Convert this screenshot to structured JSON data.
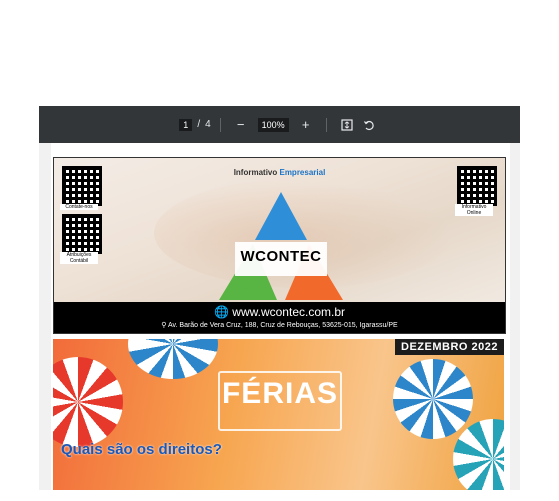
{
  "toolbar": {
    "page_current": "1",
    "page_separator": "/",
    "page_total": "4",
    "zoom": "100%",
    "zoom_out_icon": "minus-icon",
    "zoom_in_icon": "plus-icon",
    "fit_icon": "fit-page-icon",
    "rotate_icon": "rotate-icon"
  },
  "banner": {
    "title_prefix": "Informativo",
    "title_accent": "Empresarial",
    "qr_left_top_caption": "Contate-nos",
    "qr_left_bottom_caption": "Atribuições Contábil",
    "qr_right_caption": "Informativo Online",
    "logo": "WCONTEC",
    "website": "www.wcontec.com.br",
    "address": "Av. Barão de Vera Cruz, 188, Cruz de Rebouças, 53625-015, Igarassu/PE",
    "accent_color": "#1a73c8"
  },
  "cover": {
    "month": "DEZEMBRO 2022",
    "headline": "FÉRIAS",
    "question": "Quais são os direitos?"
  }
}
